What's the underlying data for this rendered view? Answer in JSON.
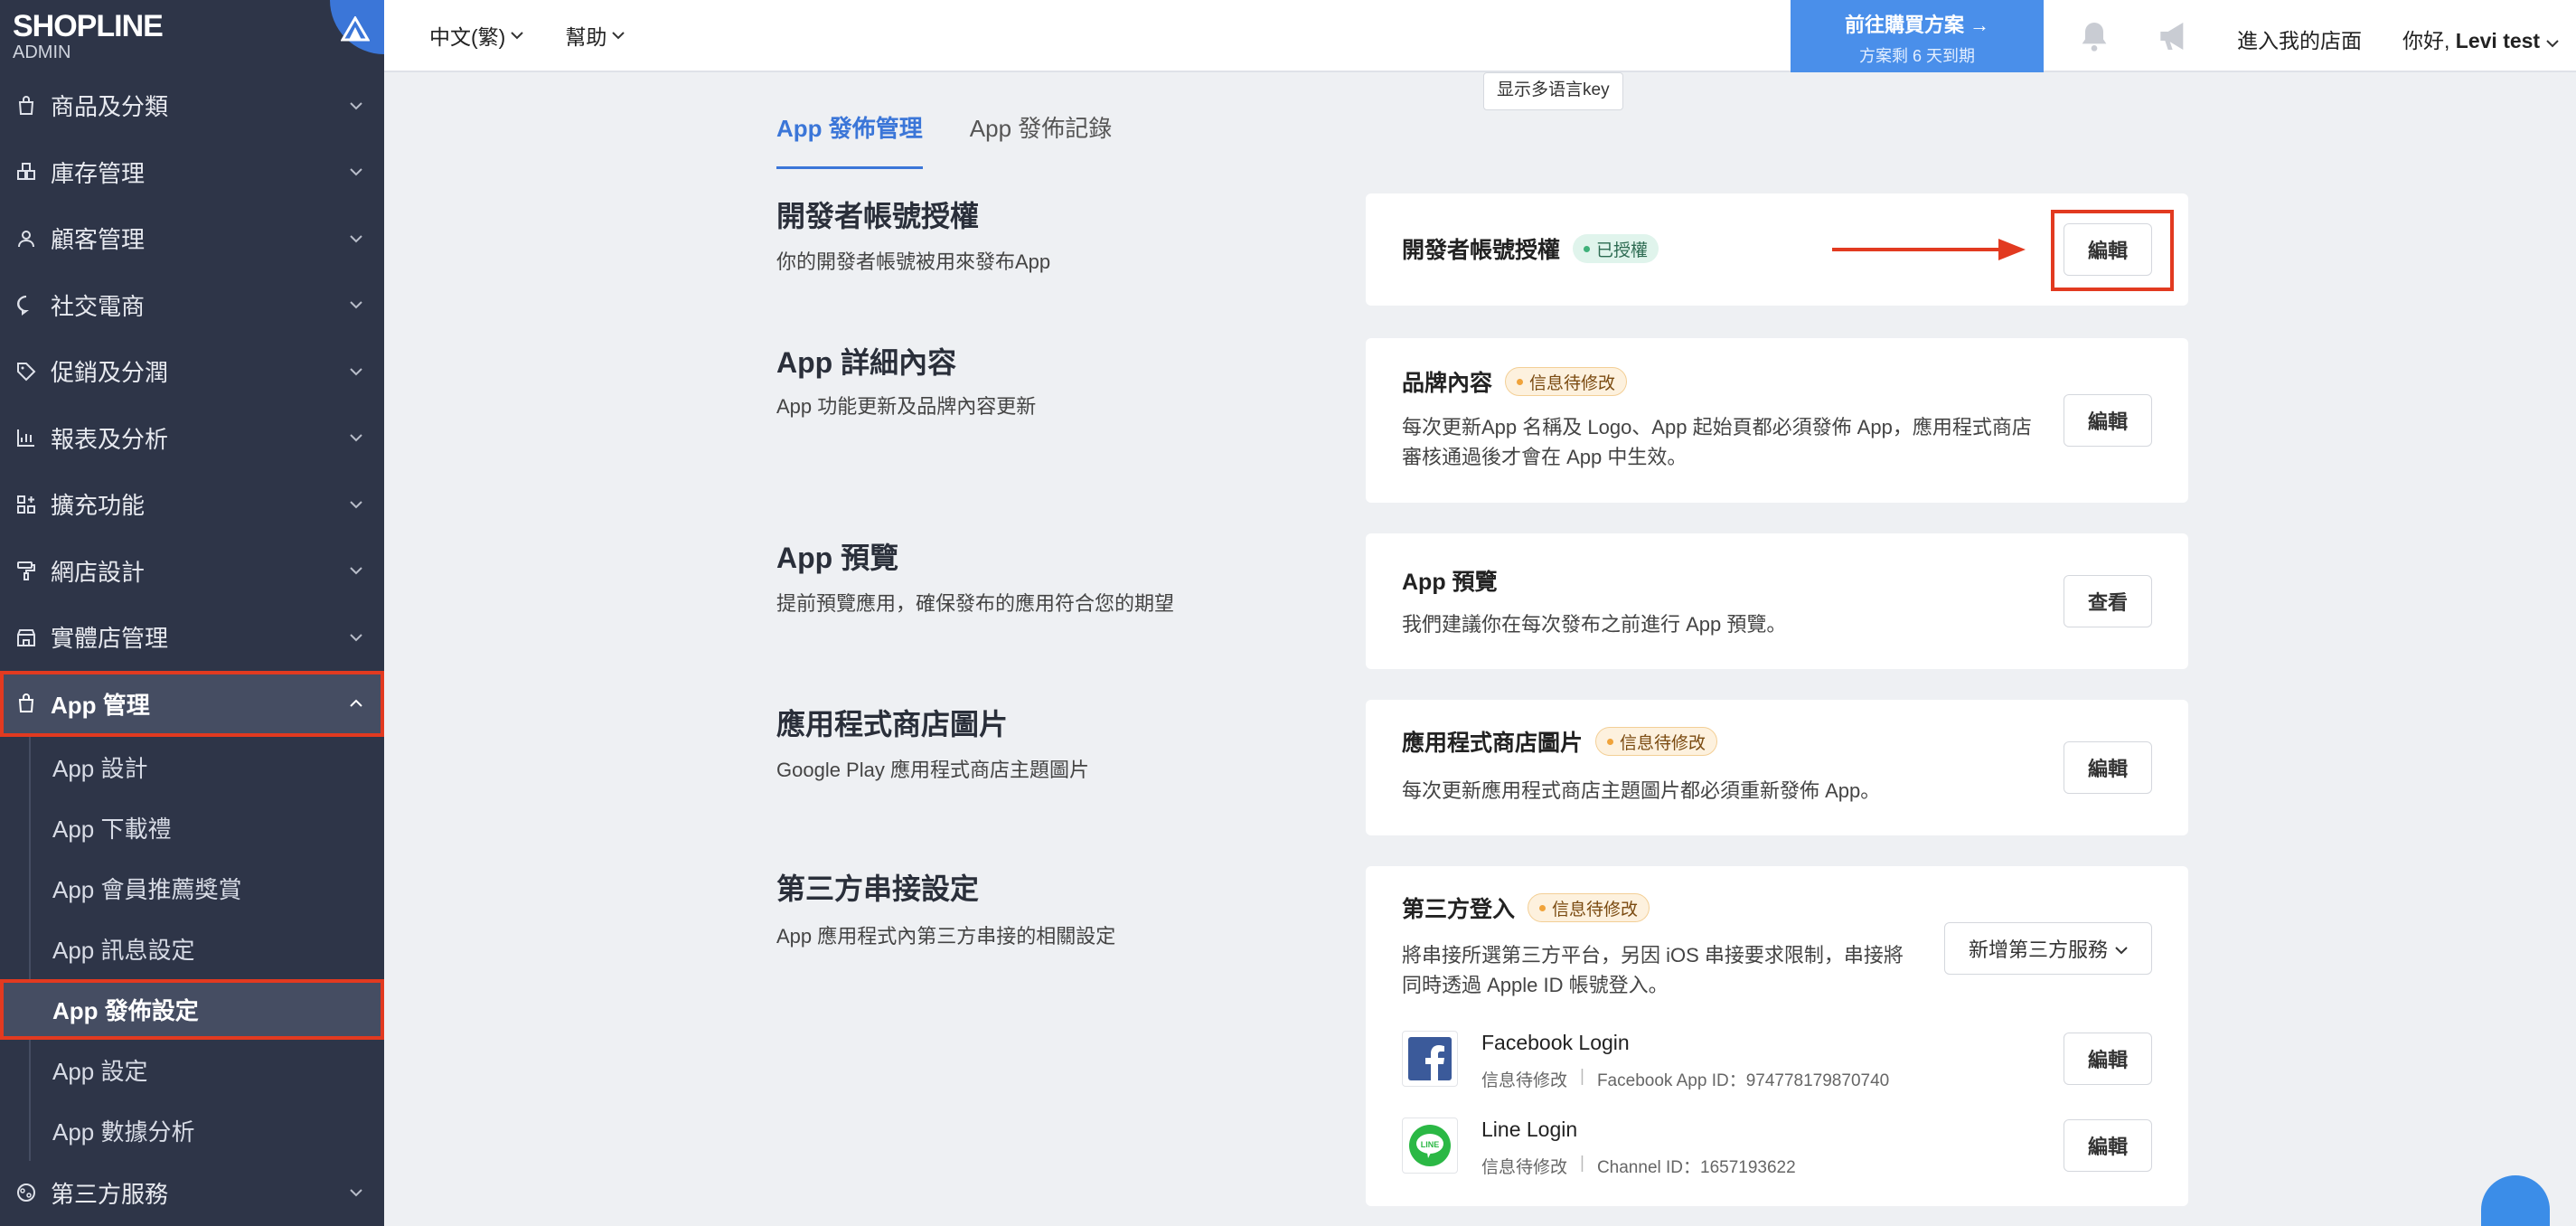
{
  "sidebar": {
    "logo_main": "SHOPLINE",
    "logo_sub": "ADMIN",
    "items": [
      {
        "label": "商品及分類",
        "icon": "bag-icon"
      },
      {
        "label": "庫存管理",
        "icon": "inventory-icon"
      },
      {
        "label": "顧客管理",
        "icon": "user-icon"
      },
      {
        "label": "社交電商",
        "icon": "chat-icon"
      },
      {
        "label": "促銷及分潤",
        "icon": "tag-icon"
      },
      {
        "label": "報表及分析",
        "icon": "chart-icon"
      },
      {
        "label": "擴充功能",
        "icon": "apps-icon"
      },
      {
        "label": "網店設計",
        "icon": "brush-icon"
      },
      {
        "label": "實體店管理",
        "icon": "store-icon"
      },
      {
        "label": "App 管理",
        "icon": "bag-icon"
      }
    ],
    "sub_items": [
      {
        "label": "App 設計"
      },
      {
        "label": "App 下載禮"
      },
      {
        "label": "App 會員推薦獎賞"
      },
      {
        "label": "App 訊息設定"
      },
      {
        "label": "App 發佈設定"
      },
      {
        "label": "App 設定"
      },
      {
        "label": "App 數據分析"
      }
    ],
    "last_item": {
      "label": "第三方服務",
      "icon": "globe-icon"
    }
  },
  "topbar": {
    "lang": "中文(繁)",
    "help": "幫助",
    "upgrade_title": "前往購買方案 →",
    "upgrade_sub": "方案剩 6 天到期",
    "store_link": "進入我的店面",
    "greeting": "你好,",
    "user_name": "Levi test"
  },
  "main": {
    "lang_key_button": "显示多语言key",
    "tabs": [
      "App 發佈管理",
      "App 發佈記錄"
    ],
    "sections": [
      {
        "title": "開發者帳號授權",
        "desc": "你的開發者帳號被用來發布App",
        "card_title": "開發者帳號授權",
        "badge": "已授權",
        "button": "編輯"
      },
      {
        "title": "App 詳細內容",
        "desc": "App 功能更新及品牌內容更新",
        "card_title": "品牌內容",
        "badge": "信息待修改",
        "text_line1": "每次更新App 名稱及 Logo、App 起始頁都必須發佈 App，應用程式商店",
        "text_line2": "審核通過後才會在 App 中生效。",
        "button": "編輯"
      },
      {
        "title": "App 預覽",
        "desc": "提前預覽應用，確保發布的應用符合您的期望",
        "card_title": "App 預覽",
        "text": "我們建議你在每次發布之前進行 App 預覽。",
        "button": "查看"
      },
      {
        "title": "應用程式商店圖片",
        "desc": "Google Play 應用程式商店主題圖片",
        "card_title": "應用程式商店圖片",
        "badge": "信息待修改",
        "text": "每次更新應用程式商店主題圖片都必須重新發佈 App。",
        "button": "編輯"
      },
      {
        "title": "第三方串接設定",
        "desc": "App 應用程式內第三方串接的相關設定",
        "card_title": "第三方登入",
        "badge": "信息待修改",
        "text_line1": "將串接所選第三方平台，另因 iOS 串接要求限制，串接將",
        "text_line2": "同時透過 Apple ID 帳號登入。",
        "add_button": "新增第三方服務",
        "logins": [
          {
            "name": "Facebook Login",
            "status": "信息待修改",
            "id_text": "Facebook App ID：974778179870740",
            "button": "編輯",
            "icon": "facebook-icon"
          },
          {
            "name": "Line Login",
            "status": "信息待修改",
            "id_text": "Channel ID：1657193622",
            "button": "編輯",
            "icon": "line-icon"
          }
        ]
      }
    ]
  },
  "colors": {
    "sidebar_bg": "#2e3548",
    "accent": "#3b76d8",
    "highlight": "#e23a20"
  }
}
